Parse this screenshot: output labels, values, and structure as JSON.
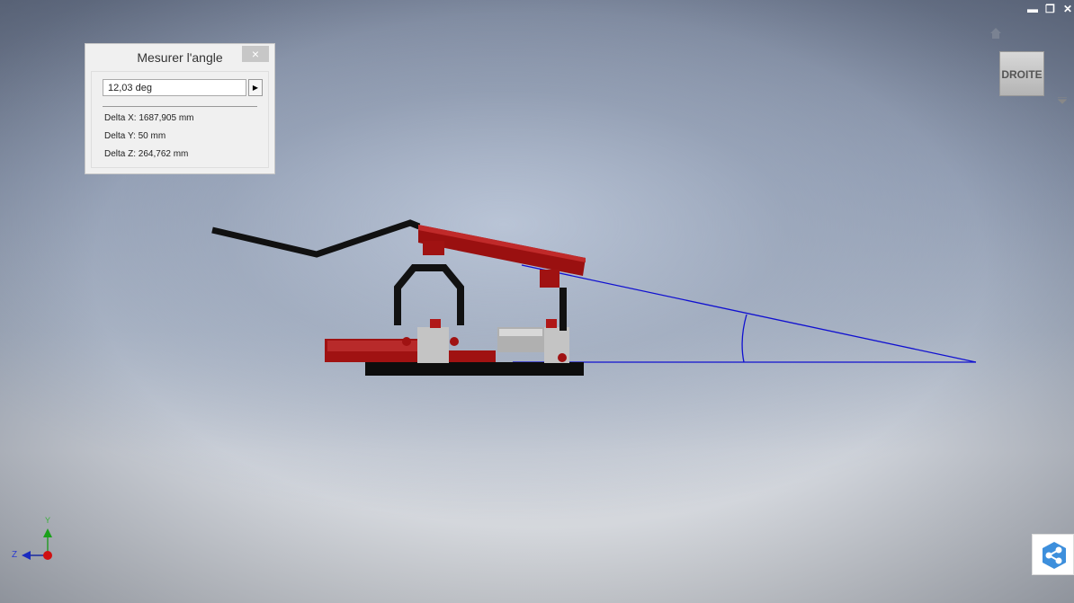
{
  "measure_panel": {
    "title": "Mesurer l'angle",
    "close": "×",
    "value": "12,03 deg",
    "delta_x": "Delta X: 1687,905 mm",
    "delta_y": "Delta Y: 50 mm",
    "delta_z": "Delta Z: 264,762 mm"
  },
  "window_controls": {
    "minimize": "▬",
    "restore": "❐",
    "close": "✕"
  },
  "viewcube": {
    "face": "DROITE"
  },
  "axis_triad": {
    "y": "Y",
    "z": "Z"
  },
  "colors": {
    "measure_line": "#1010d0",
    "part_red": "#9a1010",
    "part_black": "#111111"
  }
}
